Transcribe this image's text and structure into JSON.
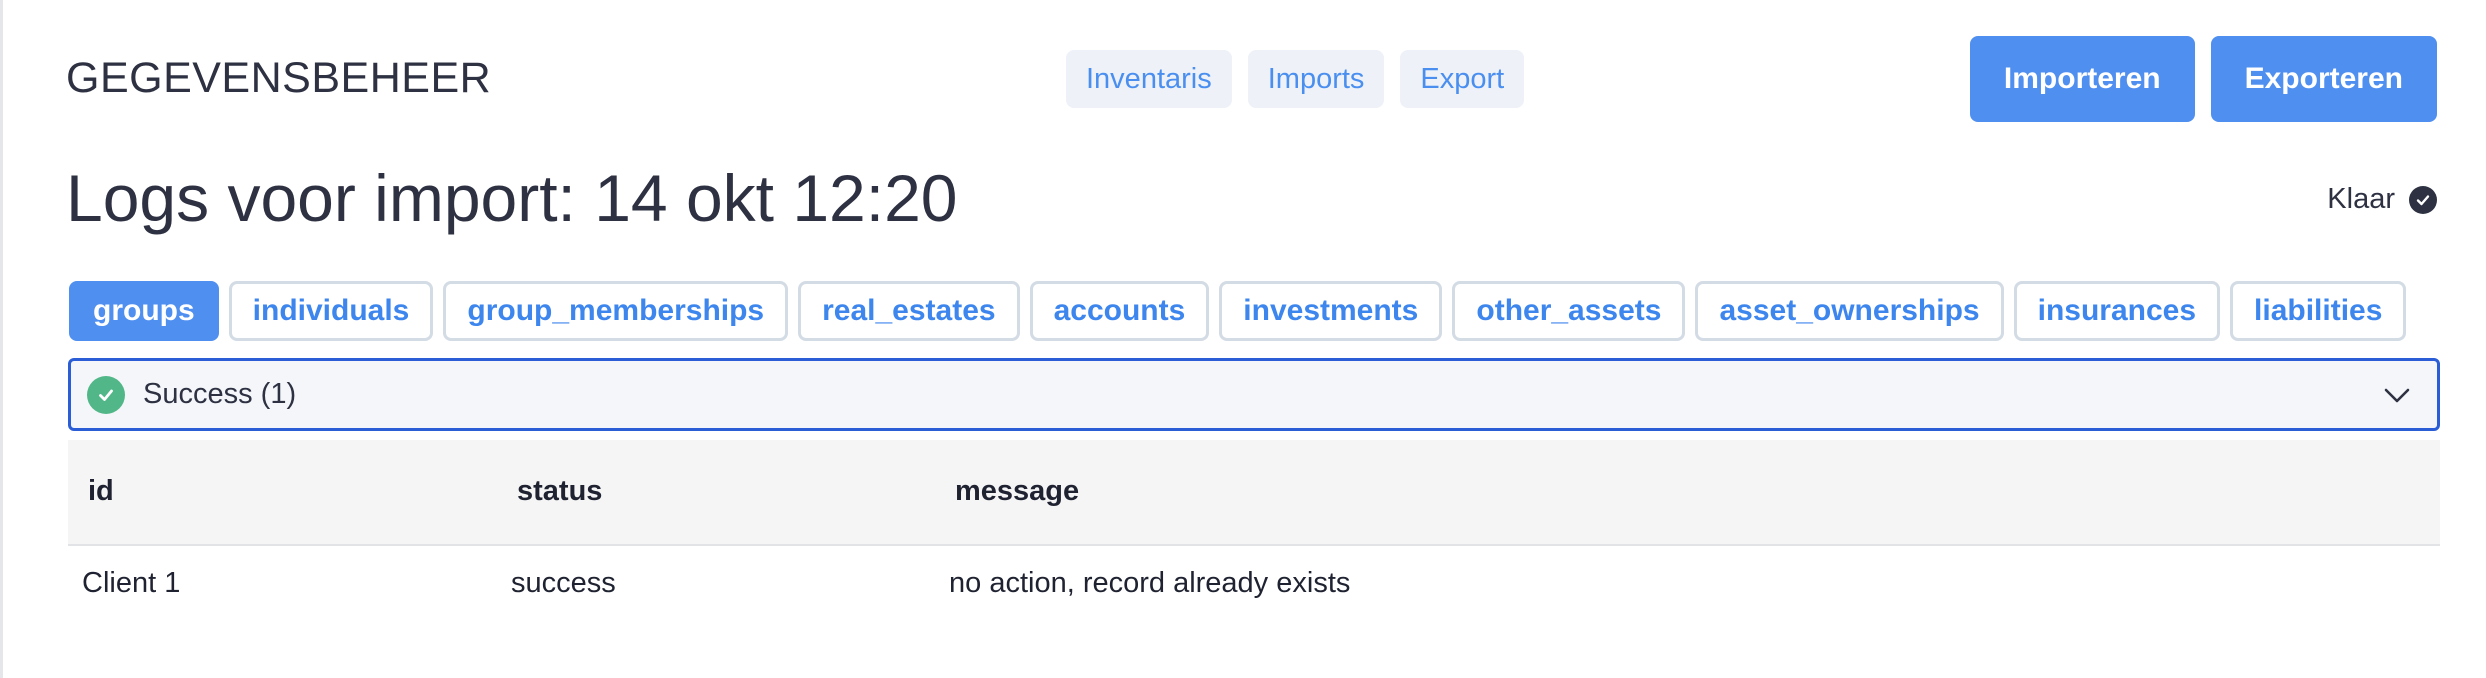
{
  "header": {
    "app_title": "GEGEVENSBEHEER",
    "nav": [
      "Inventaris",
      "Imports",
      "Export"
    ],
    "import_button": "Importeren",
    "export_button": "Exporteren"
  },
  "page": {
    "title": "Logs voor import: 14 okt 12:20",
    "status_label": "Klaar"
  },
  "tabs": {
    "active": "groups",
    "items": [
      "groups",
      "individuals",
      "group_memberships",
      "real_estates",
      "accounts",
      "investments",
      "other_assets",
      "asset_ownerships",
      "insurances",
      "liabilities"
    ]
  },
  "accordion": {
    "label": "Success (1)",
    "icon": "check-circle-icon",
    "expanded": true
  },
  "table": {
    "columns": [
      "id",
      "status",
      "message"
    ],
    "rows": [
      [
        "Client 1",
        "success",
        "no action, record already exists"
      ]
    ]
  },
  "colors": {
    "accent": "#4f8ff0",
    "link": "#3d86ee",
    "success": "#52b788",
    "focus_border": "#2b5ed6",
    "text": "#2d3142"
  }
}
